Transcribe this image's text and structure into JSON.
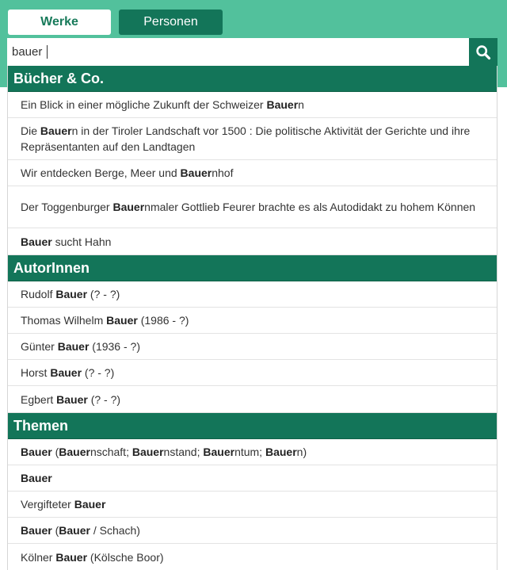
{
  "tabs": {
    "werke": "Werke",
    "personen": "Personen"
  },
  "search": {
    "value": "bauer",
    "button_icon": "search-icon"
  },
  "sections": {
    "buecher": {
      "title": "Bücher & Co.",
      "items": [
        {
          "p1": "Ein Blick in einer mögliche Zukunft der Schweizer ",
          "b1": "Bauer",
          "p2": "n"
        },
        {
          "p1": "Die ",
          "b1": "Bauer",
          "p2": "n in der Tiroler Landschaft vor 1500 : Die politische Aktivität der Gerichte und ihre Repräsentanten auf den Landtagen"
        },
        {
          "p1": "Wir entdecken Berge, Meer und ",
          "b1": "Bauer",
          "p2": "nhof"
        },
        {
          "p1": "Der Toggenburger ",
          "b1": "Bauer",
          "p2": "nmaler Gottlieb Feurer brachte es als Autodidakt zu hohem Können"
        },
        {
          "b1": "Bauer",
          "p2": " sucht Hahn"
        }
      ]
    },
    "autoren": {
      "title": "AutorInnen",
      "items": [
        {
          "p1": "Rudolf ",
          "b1": "Bauer",
          "p2": " (? - ?)"
        },
        {
          "p1": "Thomas Wilhelm ",
          "b1": "Bauer",
          "p2": " (1986 - ?)"
        },
        {
          "p1": "Günter ",
          "b1": "Bauer",
          "p2": " (1936 - ?)"
        },
        {
          "p1": "Horst ",
          "b1": "Bauer",
          "p2": " (? - ?)"
        },
        {
          "p1": "Egbert ",
          "b1": "Bauer",
          "p2": " (? - ?)"
        }
      ]
    },
    "themen": {
      "title": "Themen",
      "items": [
        {
          "b1": "Bauer",
          "p2": " (",
          "b2": "Bauer",
          "p3": "nschaft; ",
          "b3": "Bauer",
          "p4": "nstand; ",
          "b4": "Bauer",
          "p5": "ntum; ",
          "b5": "Bauer",
          "p6": "n)"
        },
        {
          "b1": "Bauer"
        },
        {
          "p1": "Vergifteter ",
          "b1": "Bauer"
        },
        {
          "b1": "Bauer",
          "p2": " (",
          "b2": "Bauer",
          "p3": " / Schach)"
        },
        {
          "p1": "Kölner ",
          "b1": "Bauer",
          "p2": " (Kölsche Boor)"
        }
      ]
    }
  },
  "colors": {
    "topbar": "#52c19c",
    "section_header": "#137559",
    "active_tab_text": "#177a5a"
  }
}
